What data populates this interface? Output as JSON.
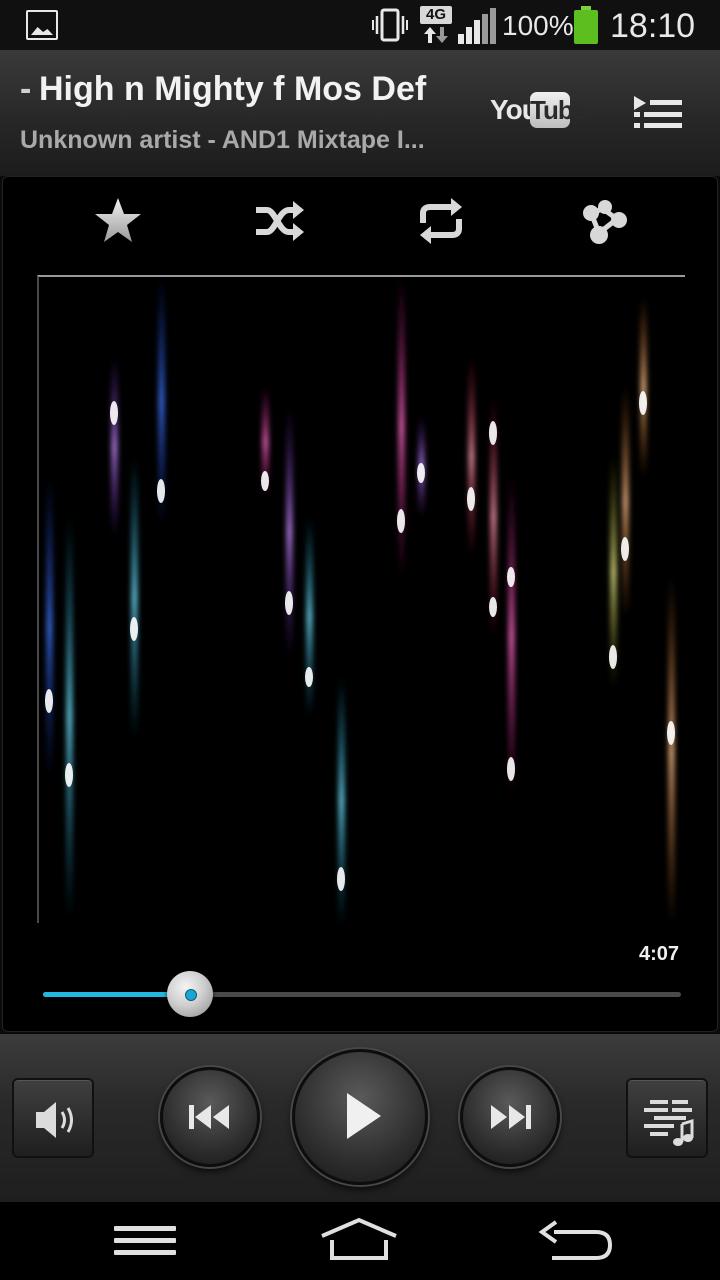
{
  "status_bar": {
    "icons": [
      "gallery-notification-icon",
      "vibrate-icon",
      "4g-data-icon",
      "signal-icon",
      "battery-icon"
    ],
    "network_type": "4G",
    "battery_percent": "100%",
    "battery_level": 1.0,
    "time": "18:10",
    "battery_color": "#5cbf1f"
  },
  "header": {
    "title_prefix": "-",
    "song_title": "High n Mighty f Mos Def",
    "song_subtitle": "Unknown artist - AND1 Mixtape I...",
    "youtube_you": "You",
    "youtube_tube": "Tube",
    "playlist_icon": "playlist-icon"
  },
  "player_controls": {
    "icons": [
      "star-icon",
      "shuffle-icon",
      "repeat-icon",
      "share-icon"
    ]
  },
  "visualizer": {
    "type": "particle-streaks"
  },
  "playback": {
    "duration": "4:07",
    "progress": 0.23,
    "accent_color": "#22b8e0"
  },
  "transport": {
    "icons": [
      "volume-icon",
      "previous-icon",
      "play-icon",
      "next-icon",
      "equalizer-icon"
    ]
  },
  "navbar": {
    "icons": [
      "menu-icon",
      "home-icon",
      "back-icon"
    ]
  }
}
